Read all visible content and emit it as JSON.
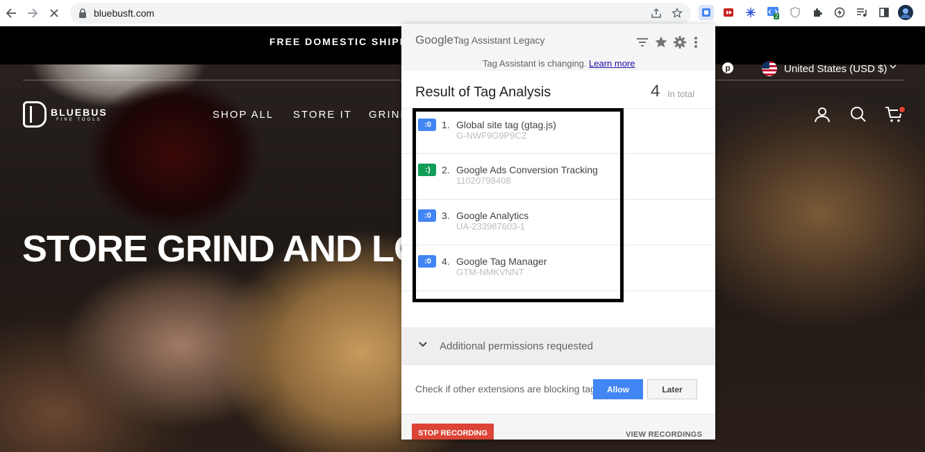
{
  "browser": {
    "url": "bluebusft.com"
  },
  "site": {
    "promo": "FREE DOMESTIC SHIPPING",
    "pinterest_label": "p",
    "currency": "United States (USD $)",
    "logo": {
      "brand": "BLUEBUS",
      "sub": "FINE TOOLS"
    },
    "nav": [
      "SHOP ALL",
      "STORE IT",
      "GRIND"
    ],
    "hero": "STORE GRIND AND LOA"
  },
  "popup": {
    "google": "Google",
    "product": "Tag Assistant Legacy",
    "changing_text": "Tag Assistant is changing.",
    "learn_more": "Learn more",
    "result_title": "Result of Tag Analysis",
    "count": "4",
    "count_label": "In total",
    "tags": [
      {
        "num": "1.",
        "name": "Global site tag (gtag.js)",
        "id": "G-NWF9G9P9CZ",
        "color": "#4285f4",
        "icon_glyph": ":0"
      },
      {
        "num": "2.",
        "name": "Google Ads Conversion Tracking",
        "id": "11020798408",
        "color": "#0f9d58",
        "icon_glyph": ":)"
      },
      {
        "num": "3.",
        "name": "Google Analytics",
        "id": "UA-233987603-1",
        "color": "#4285f4",
        "icon_glyph": ":0"
      },
      {
        "num": "4.",
        "name": "Google Tag Manager",
        "id": "GTM-NMKVNNT",
        "color": "#4285f4",
        "icon_glyph": ":0"
      }
    ],
    "permissions_text": "Additional permissions requested",
    "check_text": "Check if other extensions are blocking tags",
    "allow_label": "Allow",
    "later_label": "Later",
    "stop_label": "STOP RECORDING",
    "view_label": "VIEW RECORDINGS"
  },
  "extensions": {
    "badge_count": "2"
  }
}
